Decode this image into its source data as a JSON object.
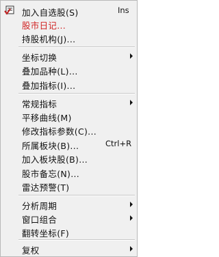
{
  "menu": {
    "items": [
      {
        "label": "加入自选股(S)",
        "shortcut": "Ins"
      },
      {
        "label": "股市日记..."
      },
      {
        "label": "持股机构(J)..."
      },
      {
        "label": "坐标切换"
      },
      {
        "label": "叠加品种(L)..."
      },
      {
        "label": "叠加指标(I)..."
      },
      {
        "label": "常规指标"
      },
      {
        "label": "平移曲线(M)"
      },
      {
        "label": "修改指标参数(C)..."
      },
      {
        "label": "所属板块(B)...",
        "shortcut": "Ctrl+R"
      },
      {
        "label": "加入板块股(B)..."
      },
      {
        "label": "股市备忘(N)..."
      },
      {
        "label": "雷达预警(T)"
      },
      {
        "label": "分析周期"
      },
      {
        "label": "窗口组合"
      },
      {
        "label": "翻转坐标(F)"
      },
      {
        "label": "复权"
      }
    ]
  },
  "icons": {
    "first_item": "add-to-watchlist-icon"
  },
  "colors": {
    "menu_bg": "#f0f0f0",
    "highlight_text": "#d02020"
  }
}
